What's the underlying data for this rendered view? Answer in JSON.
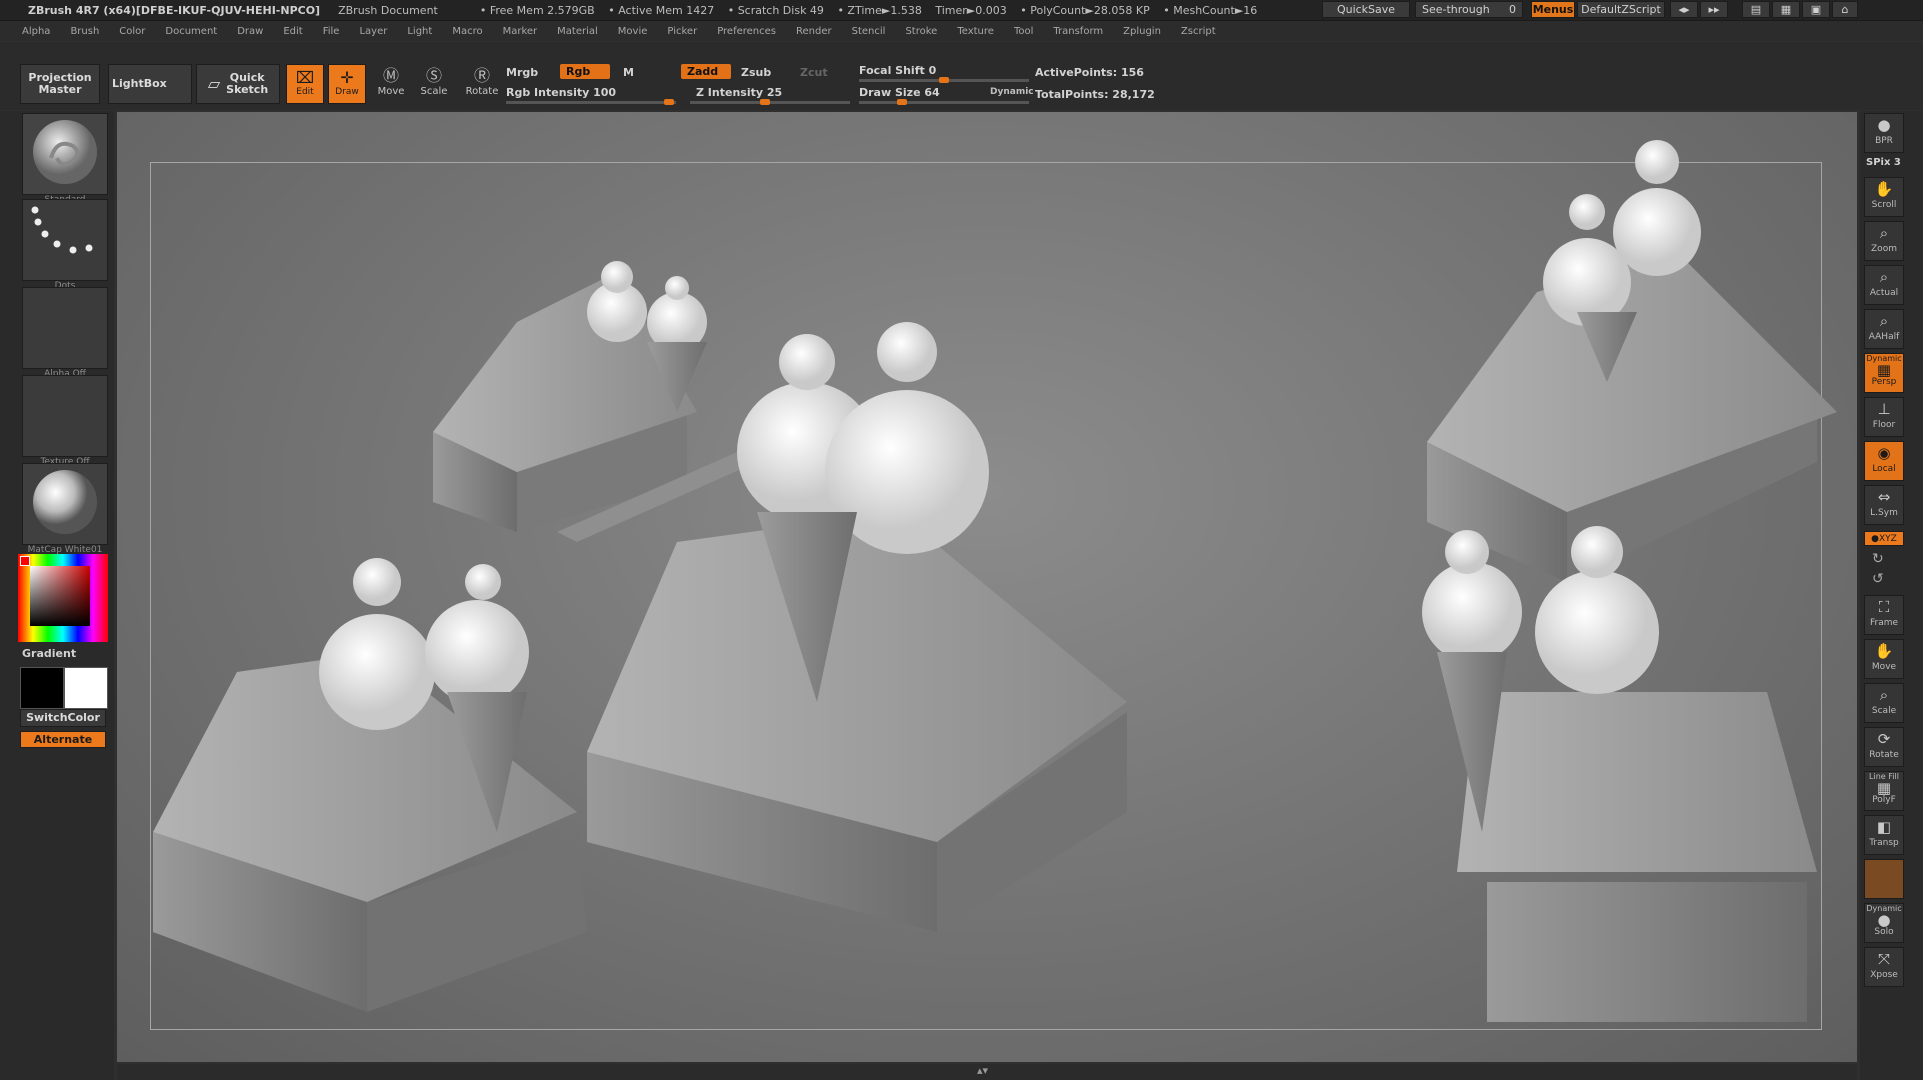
{
  "title": {
    "app": "ZBrush 4R7 (x64)[DFBE-IKUF-QJUV-HEHI-NPCO]",
    "document": "ZBrush Document",
    "stats": [
      "• Free Mem 2.579GB",
      "• Active Mem 1427",
      "• Scratch Disk 49",
      "• ZTime►1.538",
      "Timer►0.003",
      "• PolyCount►28.058 KP",
      "• MeshCount►16"
    ],
    "quicksave": "QuickSave",
    "see_through": "See-through",
    "see_through_value": "0",
    "menus": "Menus",
    "default_zscript": "DefaultZScript"
  },
  "menu": [
    "Alpha",
    "Brush",
    "Color",
    "Document",
    "Draw",
    "Edit",
    "File",
    "Layer",
    "Light",
    "Macro",
    "Marker",
    "Material",
    "Movie",
    "Picker",
    "Preferences",
    "Render",
    "Stencil",
    "Stroke",
    "Texture",
    "Tool",
    "Transform",
    "Zplugin",
    "Zscript"
  ],
  "toolbar": {
    "projection_master": "Projection\nMaster",
    "lightbox": "LightBox",
    "quick_sketch": "Quick\nSketch",
    "edit": "Edit",
    "draw": "Draw",
    "move": "Move",
    "scale": "Scale",
    "rotate": "Rotate",
    "mrgb": "Mrgb",
    "rgb": "Rgb",
    "m": "M",
    "rgb_intensity": "Rgb Intensity 100",
    "zadd": "Zadd",
    "zsub": "Zsub",
    "zcut": "Zcut",
    "z_intensity": "Z Intensity 25",
    "focal_shift": "Focal Shift 0",
    "draw_size": "Draw Size 64",
    "dynamic": "Dynamic",
    "active_points": "ActivePoints: 156",
    "total_points": "TotalPoints: 28,172"
  },
  "left_shelf": {
    "brush": "Standard",
    "stroke": "Dots",
    "alpha": "Alpha Off",
    "texture": "Texture Off",
    "material": "MatCap White01",
    "gradient": "Gradient",
    "switch_color": "SwitchColor",
    "alternate": "Alternate"
  },
  "right_shelf": {
    "bpr": "BPR",
    "spix": "SPix 3",
    "scroll": "Scroll",
    "zoom": "Zoom",
    "actual": "Actual",
    "aahalf": "AAHalf",
    "persp_top": "Dynamic",
    "persp": "Persp",
    "floor": "Floor",
    "local": "Local",
    "lsym": "L.Sym",
    "xyz": "●XYZ",
    "frame": "Frame",
    "move": "Move",
    "scale": "Scale",
    "rotate": "Rotate",
    "linefill": "Line Fill",
    "polyf": "PolyF",
    "transp": "Transp",
    "solo_top": "Dynamic",
    "solo": "Solo",
    "xpose": "Xpose"
  },
  "colors": {
    "accent": "#e57418",
    "panel": "#2b2b2b",
    "canvas": "#7d7d7d"
  }
}
